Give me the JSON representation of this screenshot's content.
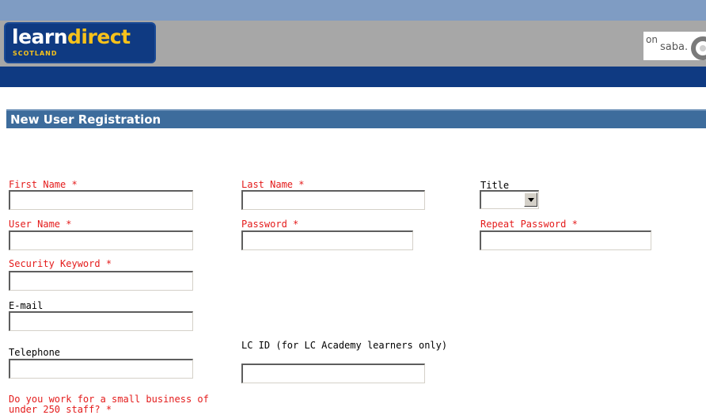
{
  "header": {
    "logo": {
      "word_learn": "learn",
      "word_direct": "direct",
      "region": "SCOTLAND"
    },
    "partner_logo": {
      "prefix": "on",
      "name": "saba."
    },
    "colors": {
      "top_strip": "#7f9cc3",
      "header_band": "#a7a7a7",
      "blue_bar": "#0f3a82"
    }
  },
  "form": {
    "title": "New User Registration",
    "colors": {
      "title_bar": "#3d6c9c",
      "required_label": "#e41b1b"
    },
    "fields": {
      "first_name": {
        "label": "First Name *",
        "value": ""
      },
      "last_name": {
        "label": "Last Name *",
        "value": ""
      },
      "title": {
        "label": "Title",
        "selected": ""
      },
      "user_name": {
        "label": "User Name *",
        "value": ""
      },
      "password": {
        "label": "Password *",
        "value": ""
      },
      "repeat_password": {
        "label": "Repeat Password *",
        "value": ""
      },
      "security_keyword": {
        "label": "Security Keyword *",
        "value": ""
      },
      "email": {
        "label": "E-mail",
        "value": ""
      },
      "telephone": {
        "label": "Telephone",
        "value": ""
      },
      "lc_id": {
        "label": "LC ID (for LC Academy learners only)",
        "value": ""
      },
      "small_business": {
        "label": "Do you work for a small business of under 250 staff? *"
      }
    }
  }
}
